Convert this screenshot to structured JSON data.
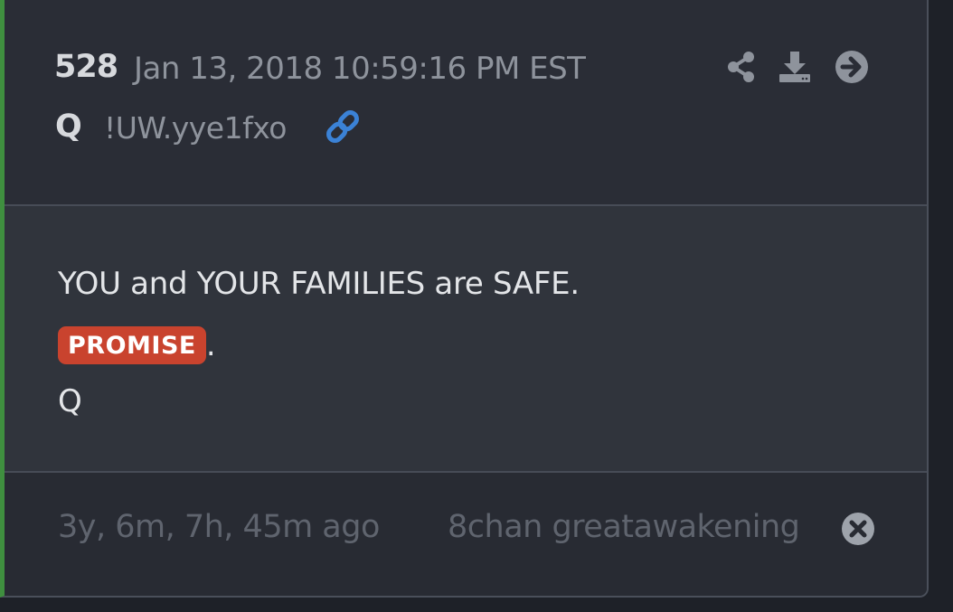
{
  "post": {
    "number": "528",
    "date": "Jan 13, 2018 10:59:16 PM EST",
    "author": "Q",
    "tripcode": "!UW.yye1fxo"
  },
  "icons": {
    "link": "link-icon",
    "share": "share-icon",
    "download": "download-icon",
    "goto": "arrow-circle-right-icon",
    "close": "close-circle-icon"
  },
  "body": {
    "line1": "YOU and YOUR FAMILIES are SAFE.",
    "badge": "PROMISE",
    "badge_suffix": ".",
    "line3": "Q"
  },
  "footer": {
    "ago": "3y, 6m, 7h, 45m ago",
    "source": "8chan greatawakening"
  },
  "colors": {
    "accent_green": "#3f8f3f",
    "badge_red": "#c9432e",
    "link_blue": "#3b82d6"
  }
}
